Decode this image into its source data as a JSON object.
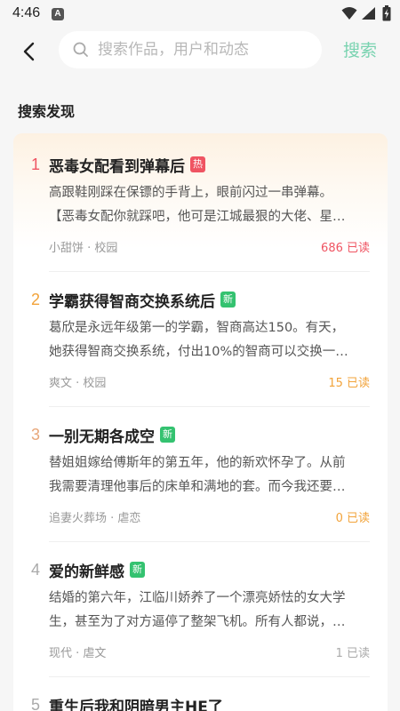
{
  "status_bar": {
    "time": "4:46",
    "app_icon_letter": "A",
    "icons": [
      "wifi-icon",
      "signal-icon",
      "battery-icon"
    ]
  },
  "header": {
    "back_icon": "chevron-left-icon",
    "search_placeholder": "搜索作品，用户和动态",
    "search_value": "",
    "search_button": "搜索"
  },
  "section_title": "搜索发现",
  "colors": {
    "accent_green": "#79d3b0",
    "rank_1": "#ef5462",
    "rank_2": "#f2a33a",
    "rank_3": "#e8a77a",
    "rank_other": "#aaaaaa",
    "hot_badge": "#ef5462",
    "new_badge": "#34c270"
  },
  "items": [
    {
      "rank": "1",
      "title": "恶毒女配看到弹幕后",
      "badge": "热",
      "badge_type": "hot",
      "desc_line1": "高跟鞋刚踩在保镖的手背上，眼前闪过一串弹幕。",
      "desc_line2": "【恶毒女配你就踩吧，他可是江城最狠的大佬、星…",
      "meta": "小甜饼 · 校园",
      "reads": "686 已读",
      "reads_color": "#ef5462"
    },
    {
      "rank": "2",
      "title": "学霸获得智商交换系统后",
      "badge": "新",
      "badge_type": "new",
      "desc_line1": "葛欣是永远年级第一的学霸，智商高达150。有天，",
      "desc_line2": "她获得智商交换系统，付出10%的智商可以交换一…",
      "meta": "爽文 · 校园",
      "reads": "15 已读",
      "reads_color": "#f2a33a"
    },
    {
      "rank": "3",
      "title": "一别无期各成空",
      "badge": "新",
      "badge_type": "new",
      "desc_line1": "替姐姐嫁给傅斯年的第五年，他的新欢怀孕了。从前",
      "desc_line2": "我需要清理他事后的床单和满地的套。而今我还要…",
      "meta": "追妻火葬场 · 虐恋",
      "reads": "0 已读",
      "reads_color": "#f2a33a"
    },
    {
      "rank": "4",
      "title": "爱的新鲜感",
      "badge": "新",
      "badge_type": "new",
      "desc_line1": "结婚的第六年，江临川娇养了一个漂亮娇怯的女大学",
      "desc_line2": "生，甚至为了对方逼停了整架飞机。所有人都说，…",
      "meta": "现代 · 虐文",
      "reads": "1 已读",
      "reads_color": "#aaaaaa"
    },
    {
      "rank": "5",
      "title": "重生后我和阴暗男主HE了",
      "badge": "",
      "badge_type": "",
      "desc_line1": "",
      "desc_line2": "",
      "meta": "",
      "reads": "",
      "reads_color": "#aaaaaa"
    }
  ]
}
